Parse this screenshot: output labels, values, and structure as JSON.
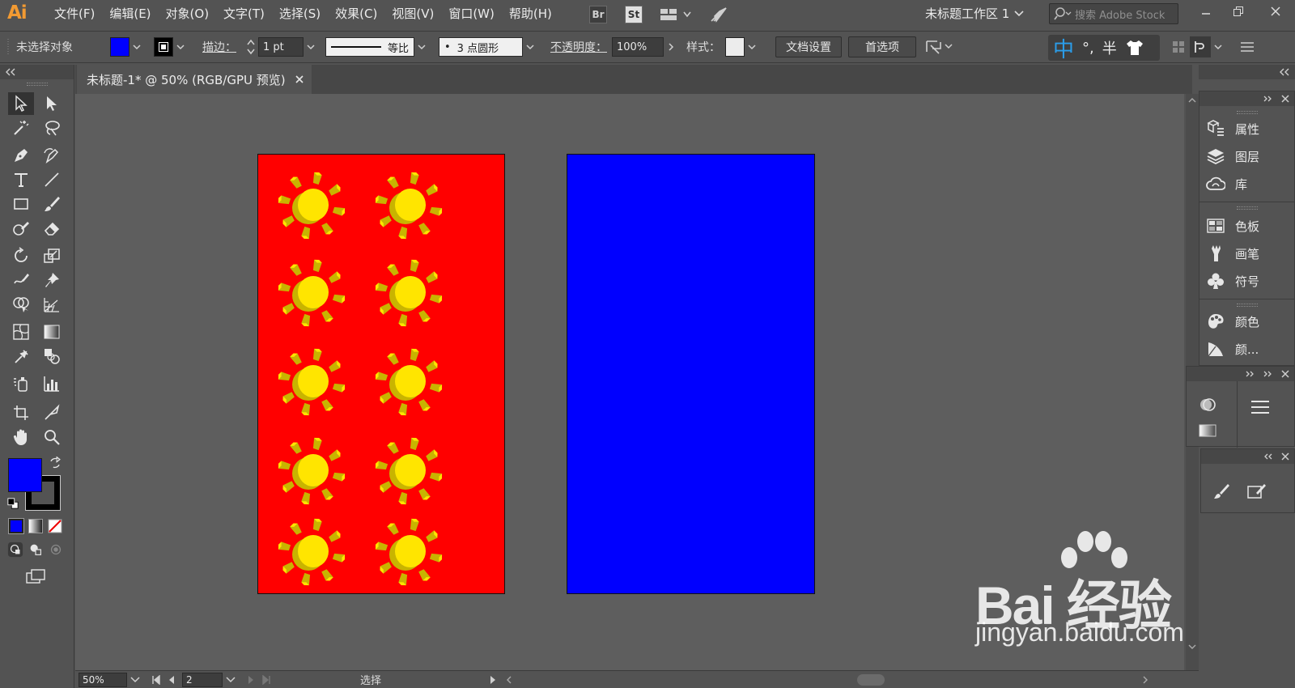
{
  "app": {
    "logo": "Ai",
    "menu": [
      "文件(F)",
      "编辑(E)",
      "对象(O)",
      "文字(T)",
      "选择(S)",
      "效果(C)",
      "视图(V)",
      "窗口(W)",
      "帮助(H)"
    ],
    "bridge_badge": "Br",
    "stock_badge": "St",
    "workspace": "未标题工作区 1",
    "search_placeholder": "搜索 Adobe Stock"
  },
  "control_bar": {
    "selection_status": "未选择对象",
    "fill_color": "#0000ff",
    "stroke_label": "描边：",
    "stroke_weight": "1 pt",
    "stroke_profile": "等比",
    "brush": "3 点圆形",
    "brush_dot": "•",
    "opacity_label": "不透明度：",
    "opacity_value": "100%",
    "style_label": "样式：",
    "doc_setup_button": "文档设置",
    "preferences_button": "首选项"
  },
  "ime_bar": {
    "mode": "中",
    "punct": "°,",
    "width": "半"
  },
  "document": {
    "tab_title": "未标题-1* @ 50% (RGB/GPU 预览)",
    "artboard1_color": "#ff0000",
    "artboard2_color": "#0000ff",
    "sun_color": "#ffe500",
    "sun_ray_color": "#c8b400"
  },
  "status_bar": {
    "zoom": "50%",
    "artboard_number": "2",
    "current_tool": "选择"
  },
  "tool_panel": {
    "fill_color": "#0000ff",
    "stroke_color": "#000000"
  },
  "panels": {
    "group1": [
      "属性",
      "图层",
      "库"
    ],
    "group2": [
      "色板",
      "画笔",
      "符号"
    ],
    "group3": [
      "颜色",
      "颜..."
    ]
  },
  "watermark": {
    "brand": "Bai 经验",
    "url": "jingyan.baidu.com"
  }
}
